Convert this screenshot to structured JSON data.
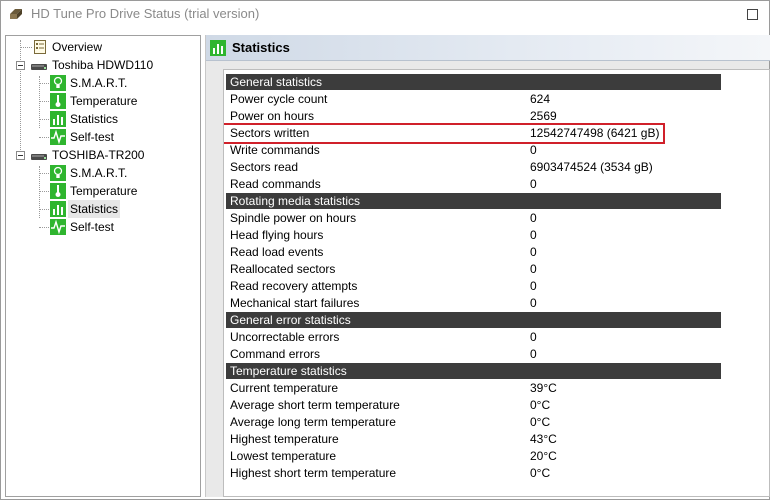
{
  "window": {
    "title": "HD Tune Pro Drive Status (trial version)"
  },
  "tree": {
    "overview": "Overview",
    "drives": [
      {
        "name": "Toshiba HDWD110",
        "children": [
          "S.M.A.R.T.",
          "Temperature",
          "Statistics",
          "Self-test"
        ]
      },
      {
        "name": "TOSHIBA-TR200",
        "children": [
          "S.M.A.R.T.",
          "Temperature",
          "Statistics",
          "Self-test"
        ]
      }
    ],
    "selected": "TOSHIBA-TR200 / Statistics"
  },
  "panel": {
    "title": "Statistics"
  },
  "sections": [
    {
      "title": "General statistics",
      "rows": [
        {
          "label": "Power cycle count",
          "value": "624"
        },
        {
          "label": "Power on hours",
          "value": "2569"
        },
        {
          "label": "Sectors written",
          "value": "12542747498 (6421 gB)"
        },
        {
          "label": "Write commands",
          "value": "0"
        },
        {
          "label": "Sectors read",
          "value": "6903474524 (3534 gB)"
        },
        {
          "label": "Read commands",
          "value": "0"
        }
      ]
    },
    {
      "title": "Rotating media statistics",
      "rows": [
        {
          "label": "Spindle power on hours",
          "value": "0"
        },
        {
          "label": "Head flying hours",
          "value": "0"
        },
        {
          "label": "Read load events",
          "value": "0"
        },
        {
          "label": "Reallocated sectors",
          "value": "0"
        },
        {
          "label": "Read recovery attempts",
          "value": "0"
        },
        {
          "label": "Mechanical start failures",
          "value": "0"
        }
      ]
    },
    {
      "title": "General error statistics",
      "rows": [
        {
          "label": "Uncorrectable errors",
          "value": "0"
        },
        {
          "label": "Command errors",
          "value": "0"
        }
      ]
    },
    {
      "title": "Temperature statistics",
      "rows": [
        {
          "label": "Current temperature",
          "value": "39°C"
        },
        {
          "label": "Average short term temperature",
          "value": "0°C"
        },
        {
          "label": "Average long term temperature",
          "value": "0°C"
        },
        {
          "label": "Highest temperature",
          "value": "43°C"
        },
        {
          "label": "Lowest temperature",
          "value": "20°C"
        },
        {
          "label": "Highest short term temperature",
          "value": "0°C"
        }
      ]
    }
  ],
  "colors": {
    "section_header": "#3c3c3c",
    "highlight_box": "#d0202a",
    "icon_green": "#2fb52f"
  }
}
